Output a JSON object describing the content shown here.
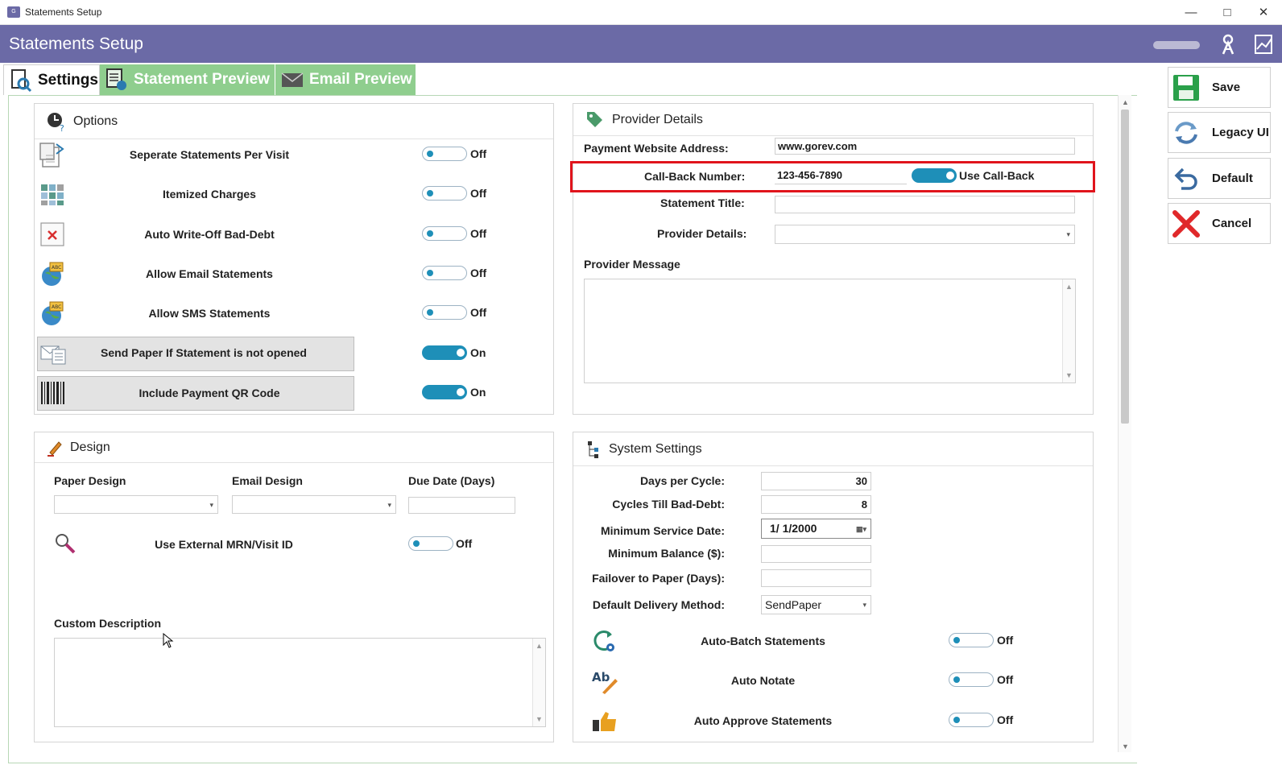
{
  "window": {
    "title": "Statements Setup",
    "app_icon_text": "Gorev"
  },
  "header": {
    "title": "Statements Setup",
    "user_name": "",
    "user_icon": "user-key-icon",
    "chart_icon": "chart-icon"
  },
  "tabs": [
    {
      "label": "Settings",
      "active": true,
      "icon": "settings-search-icon"
    },
    {
      "label": "Statement Preview",
      "active": false,
      "icon": "statement-icon"
    },
    {
      "label": "Email Preview",
      "active": false,
      "icon": "envelope-icon"
    }
  ],
  "options": {
    "title": "Options",
    "rows": [
      {
        "label": "Seperate Statements Per Visit",
        "state": "Off",
        "on": false,
        "icon": "split-document-icon"
      },
      {
        "label": "Itemized Charges",
        "state": "Off",
        "on": false,
        "icon": "grid-icon"
      },
      {
        "label": "Auto Write-Off Bad-Debt",
        "state": "Off",
        "on": false,
        "icon": "cancel-document-icon"
      },
      {
        "label": "Allow Email Statements",
        "state": "Off",
        "on": false,
        "icon": "globe-abc-icon"
      },
      {
        "label": "Allow SMS Statements",
        "state": "Off",
        "on": false,
        "icon": "globe-abc-icon"
      },
      {
        "label": "Send Paper If Statement is not opened",
        "state": "On",
        "on": true,
        "icon": "mail-document-icon"
      },
      {
        "label": "Include Payment QR Code",
        "state": "On",
        "on": true,
        "icon": "barcode-icon"
      }
    ]
  },
  "provider": {
    "title": "Provider Details",
    "website_label": "Payment Website Address:",
    "website_value": "www.gorev.com",
    "callback_label": "Call-Back Number:",
    "callback_value": "123-456-7890",
    "use_callback_label": "Use Call-Back",
    "use_callback_on": true,
    "statement_title_label": "Statement Title:",
    "statement_title_value": "",
    "provider_details_label": "Provider Details:",
    "provider_details_value": "",
    "message_label": "Provider Message",
    "message_value": "",
    "highlight_color": "#e0141c"
  },
  "design": {
    "title": "Design",
    "paper_design_label": "Paper Design",
    "paper_design_value": "",
    "email_design_label": "Email Design",
    "email_design_value": "",
    "due_date_label": "Due Date (Days)",
    "due_date_value": "",
    "external_mrn_label": "Use External MRN/Visit ID",
    "external_mrn_state": "Off",
    "custom_description_label": "Custom Description",
    "custom_description_value": ""
  },
  "system": {
    "title": "System Settings",
    "days_per_cycle_label": "Days per Cycle:",
    "days_per_cycle_value": "30",
    "cycles_bad_debt_label": "Cycles Till Bad-Debt:",
    "cycles_bad_debt_value": "8",
    "min_service_date_label": "Minimum Service Date:",
    "min_service_date_value": "1/  1/2000",
    "min_balance_label": "Minimum Balance ($):",
    "min_balance_value": "",
    "failover_label": "Failover to Paper (Days):",
    "failover_value": "",
    "delivery_label": "Default Delivery Method:",
    "delivery_value": "SendPaper",
    "rows": [
      {
        "label": "Auto-Batch Statements",
        "state": "Off",
        "icon": "refresh-gear-icon"
      },
      {
        "label": "Auto Notate",
        "state": "Off",
        "icon": "spellcheck-pencil-icon"
      },
      {
        "label": "Auto Approve Statements",
        "state": "Off",
        "icon": "thumbs-up-icon"
      }
    ]
  },
  "sidebar": {
    "save": "Save",
    "legacy": "Legacy UI",
    "default": "Default",
    "cancel": "Cancel"
  },
  "colors": {
    "header": "#6b6aa6",
    "tab_inactive": "#8fce8e",
    "toggle_on": "#1e8fb8"
  }
}
